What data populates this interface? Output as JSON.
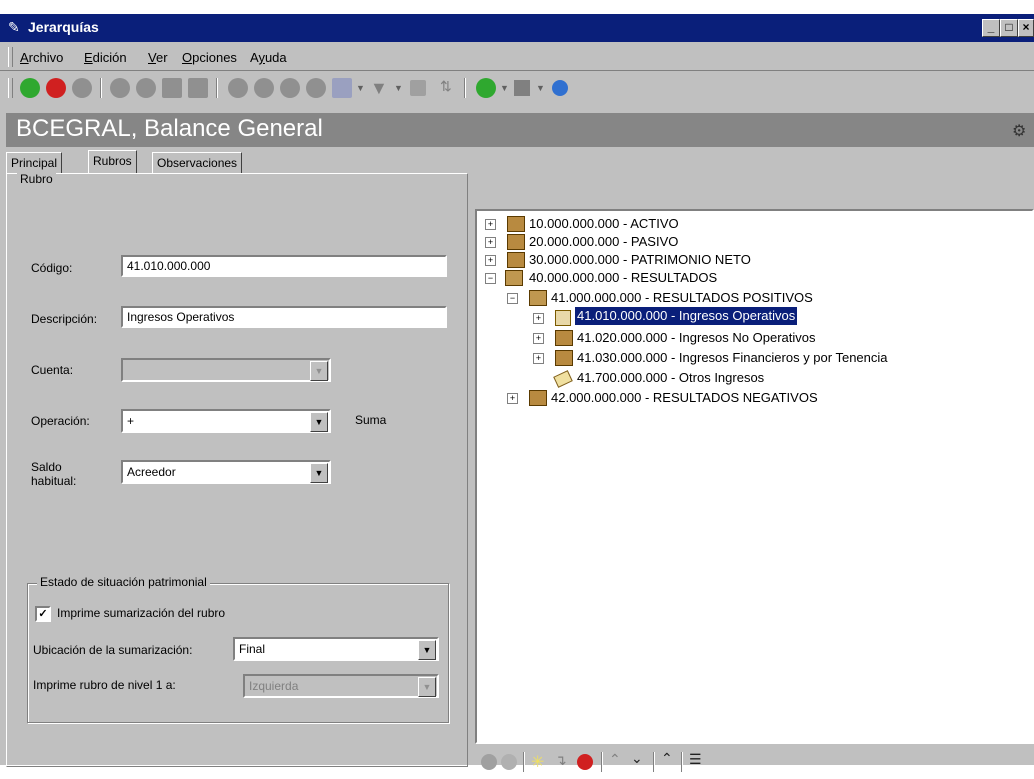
{
  "window": {
    "title": "Jerarquías"
  },
  "menu": [
    "Archivo",
    "Edición",
    "Ver",
    "Opciones",
    "Ayuda"
  ],
  "toolbar_icons": [
    "accept-icon",
    "cancel-icon",
    "add-icon",
    "remove-icon",
    "record-icon",
    "list-icon",
    "note-icon",
    "first-icon",
    "previous-icon",
    "next-icon",
    "last-icon",
    "find-icon",
    "filter-icon",
    "grid-icon",
    "sort-icon",
    "refresh-icon",
    "color-icon",
    "help-icon"
  ],
  "header": {
    "title": "BCEGRAL, Balance General"
  },
  "tabs": [
    "Principal",
    "Rubros",
    "Observaciones"
  ],
  "rubro": {
    "legend": "Rubro",
    "codigo_label": "Código:",
    "codigo_value": "41.010.000.000",
    "descripcion_label": "Descripción:",
    "descripcion_value": "Ingresos Operativos",
    "cuenta_label": "Cuenta:",
    "cuenta_value": "",
    "operacion_label": "Operación:",
    "operacion_value": "+",
    "operacion_desc": "Suma",
    "saldo_label_1": "Saldo",
    "saldo_label_2": "habitual:",
    "saldo_value": "Acreedor"
  },
  "estado": {
    "legend": "Estado de situación patrimonial",
    "imprime_label": "Imprime sumarización del rubro",
    "imprime_checked": true,
    "ubicacion_label": "Ubicación de la sumarización:",
    "ubicacion_value": "Final",
    "nivel_label": "Imprime rubro de nivel 1 a:",
    "nivel_value": "Izquierda"
  },
  "tree": [
    "10.000.000.000 - ACTIVO",
    "20.000.000.000 - PASIVO",
    "30.000.000.000 - PATRIMONIO NETO",
    "40.000.000.000 - RESULTADOS",
    "41.000.000.000 - RESULTADOS POSITIVOS",
    "41.010.000.000 - Ingresos Operativos",
    "41.020.000.000 - Ingresos No Operativos",
    "41.030.000.000 - Ingresos Financieros y por Tenencia",
    "41.700.000.000 - Otros Ingresos",
    "42.000.000.000 - RESULTADOS NEGATIVOS"
  ],
  "colors": {
    "titlebar": "#0a1f7a",
    "header": "#868686",
    "selection": "#0a1f7a"
  }
}
